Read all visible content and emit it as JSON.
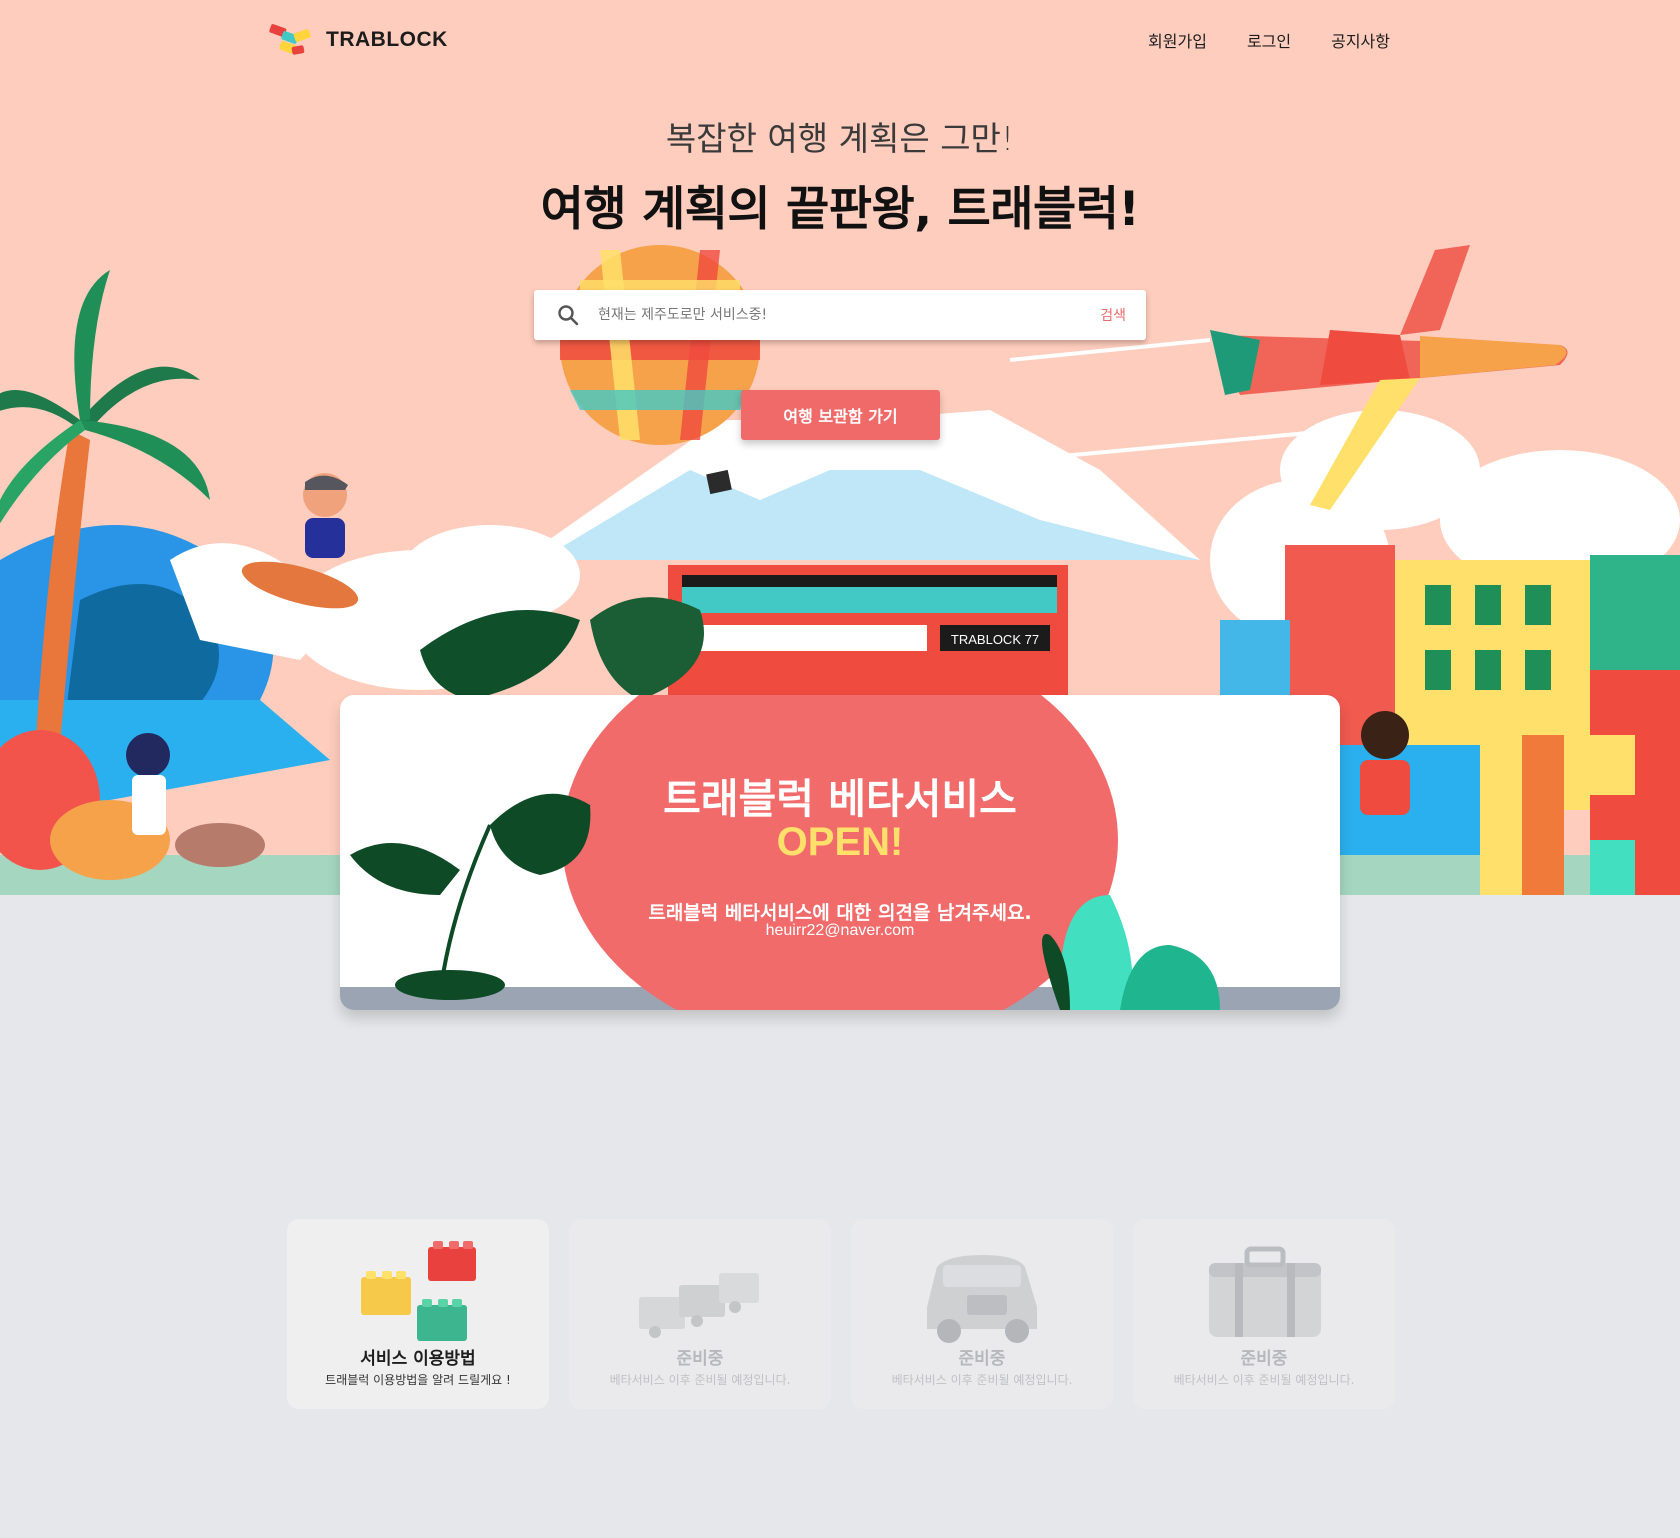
{
  "brand": {
    "name": "TRABLOCK"
  },
  "nav": {
    "signup": "회원가입",
    "login": "로그인",
    "notice": "공지사항"
  },
  "hero": {
    "subtitle": "복잡한 여행 계획은 그만!",
    "title": "여행 계획의 끝판왕, 트래블럭!",
    "bus_sign": "TRABLOCK 77"
  },
  "search": {
    "placeholder": "현재는 제주도로만 서비스중!",
    "button": "검색"
  },
  "cta": {
    "label": "여행 보관함 가기"
  },
  "banner": {
    "title": "트래블럭 베타서비스",
    "highlight": "OPEN!",
    "description": "트래블럭 베타서비스에 대한 의견을 남겨주세요.",
    "email": "heuirr22@naver.com"
  },
  "cards": [
    {
      "title": "서비스 이용방법",
      "desc": "트래블럭 이용방법을 알려 드릴게요 !",
      "icon": "lego-bricks-icon"
    },
    {
      "title": "준비중",
      "desc": "베타서비스 이후 준비될 예정입니다.",
      "icon": "lego-train-icon"
    },
    {
      "title": "준비중",
      "desc": "베타서비스 이후 준비될 예정입니다.",
      "icon": "car-icon"
    },
    {
      "title": "준비중",
      "desc": "베타서비스 이후 준비될 예정입니다.",
      "icon": "suitcase-icon"
    }
  ],
  "colors": {
    "hero_bg": "#ffcdbd",
    "page_bg": "#e6e7ea",
    "accent": "#f06a6a",
    "open_yellow": "#ffe06a",
    "disabled_text": "#b7b8bb"
  }
}
